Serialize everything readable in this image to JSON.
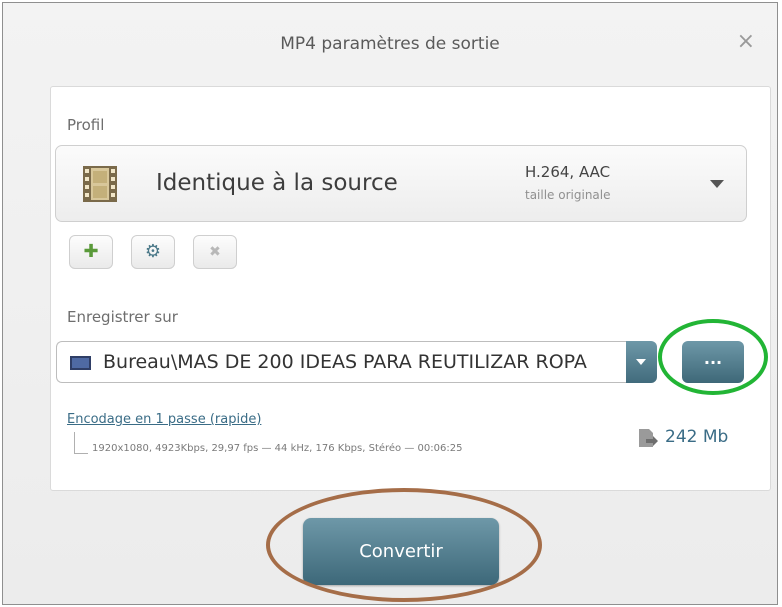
{
  "window": {
    "title": "MP4 paramètres de sortie",
    "close_glyph": "×"
  },
  "profile": {
    "section_label": "Profil",
    "name": "Identique à la source",
    "codec": "H.264, AAC",
    "size_note": "taille originale",
    "icon": "film-icon"
  },
  "profile_actions": {
    "add_glyph": "✚",
    "settings_glyph": "⚙",
    "delete_glyph": "✖"
  },
  "save": {
    "section_label": "Enregistrer sur",
    "path": "Bureau\\MAS DE 200 IDEAS PARA REUTILIZAR ROPA",
    "browse_label": "..."
  },
  "encoding": {
    "mode_link": "Encodage en 1 passe (rapide)",
    "details": "1920x1080, 4923Kbps, 29,97 fps — 44 kHz, 176 Kbps, Stéréo — 00:06:25",
    "estimated_size": "242 Mb"
  },
  "convert_label": "Convertir",
  "colors": {
    "accent": "#4a7888",
    "highlight_green": "#22b535",
    "highlight_brown": "#a56d48",
    "add_green": "#5a9a3a"
  }
}
